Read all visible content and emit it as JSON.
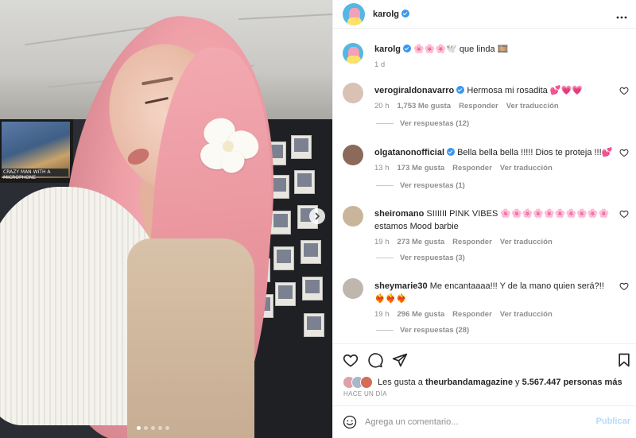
{
  "post": {
    "username": "karolg",
    "caption_user": "karolg",
    "caption_text": "🌸🌸🌸🕊️ que linda 🎞️",
    "caption_time": "1 d",
    "more_icon": "more-horizontal-icon"
  },
  "photo": {
    "tv_ticker": "CRAZY MAN WITH A MICROPHONE",
    "carousel_dots": 5,
    "active_dot": 0
  },
  "comments": [
    {
      "user": "verogiraldonavarro",
      "verified": true,
      "text": "Hermosa mi rosadita 💕💗💗",
      "time": "20 h",
      "likes": "1,753 Me gusta",
      "reply": "Responder",
      "translate": "Ver traducción",
      "replies": "Ver respuestas (12)",
      "avatar_color": "#d9c2b4"
    },
    {
      "user": "olgatanonofficial",
      "verified": true,
      "text": "Bella bella bella !!!!! Dios te proteja !!!💕",
      "time": "13 h",
      "likes": "173 Me gusta",
      "reply": "Responder",
      "translate": "Ver traducción",
      "replies": "Ver respuestas (1)",
      "avatar_color": "#8b6a5a"
    },
    {
      "user": "sheiromano",
      "verified": false,
      "text": "SIIIIII PINK VIBES 🌸🌸🌸🌸🌸🌸🌸🌸🌸🌸 estamos Mood barbie",
      "time": "19 h",
      "likes": "273 Me gusta",
      "reply": "Responder",
      "translate": "Ver traducción",
      "replies": "Ver respuestas (3)",
      "avatar_color": "#c9b59a"
    },
    {
      "user": "sheymarie30",
      "verified": false,
      "text": "Me encantaaaa!!! Y de la mano quien será?!! ❤️‍🔥❤️‍🔥❤️‍🔥",
      "time": "19 h",
      "likes": "296 Me gusta",
      "reply": "Responder",
      "translate": "Ver traducción",
      "replies": "Ver respuestas (28)",
      "avatar_color": "#bfb6ad"
    }
  ],
  "actions": {
    "like_icon": "heart-icon",
    "comment_icon": "comment-icon",
    "share_icon": "send-icon",
    "save_icon": "bookmark-icon"
  },
  "likes_line": {
    "prefix": "Les gusta a",
    "user": "theurbandamagazine",
    "joiner": "y",
    "others": "5.567.447 personas más"
  },
  "ago": "HACE UN DÍA",
  "add_comment": {
    "placeholder": "Agrega un comentario...",
    "publish": "Publicar",
    "emoji_icon": "emoji-icon"
  },
  "colors": {
    "verified": "#3897f0",
    "publish_disabled": "#b3dbff",
    "muted": "#8e8e8e",
    "text": "#262626"
  }
}
